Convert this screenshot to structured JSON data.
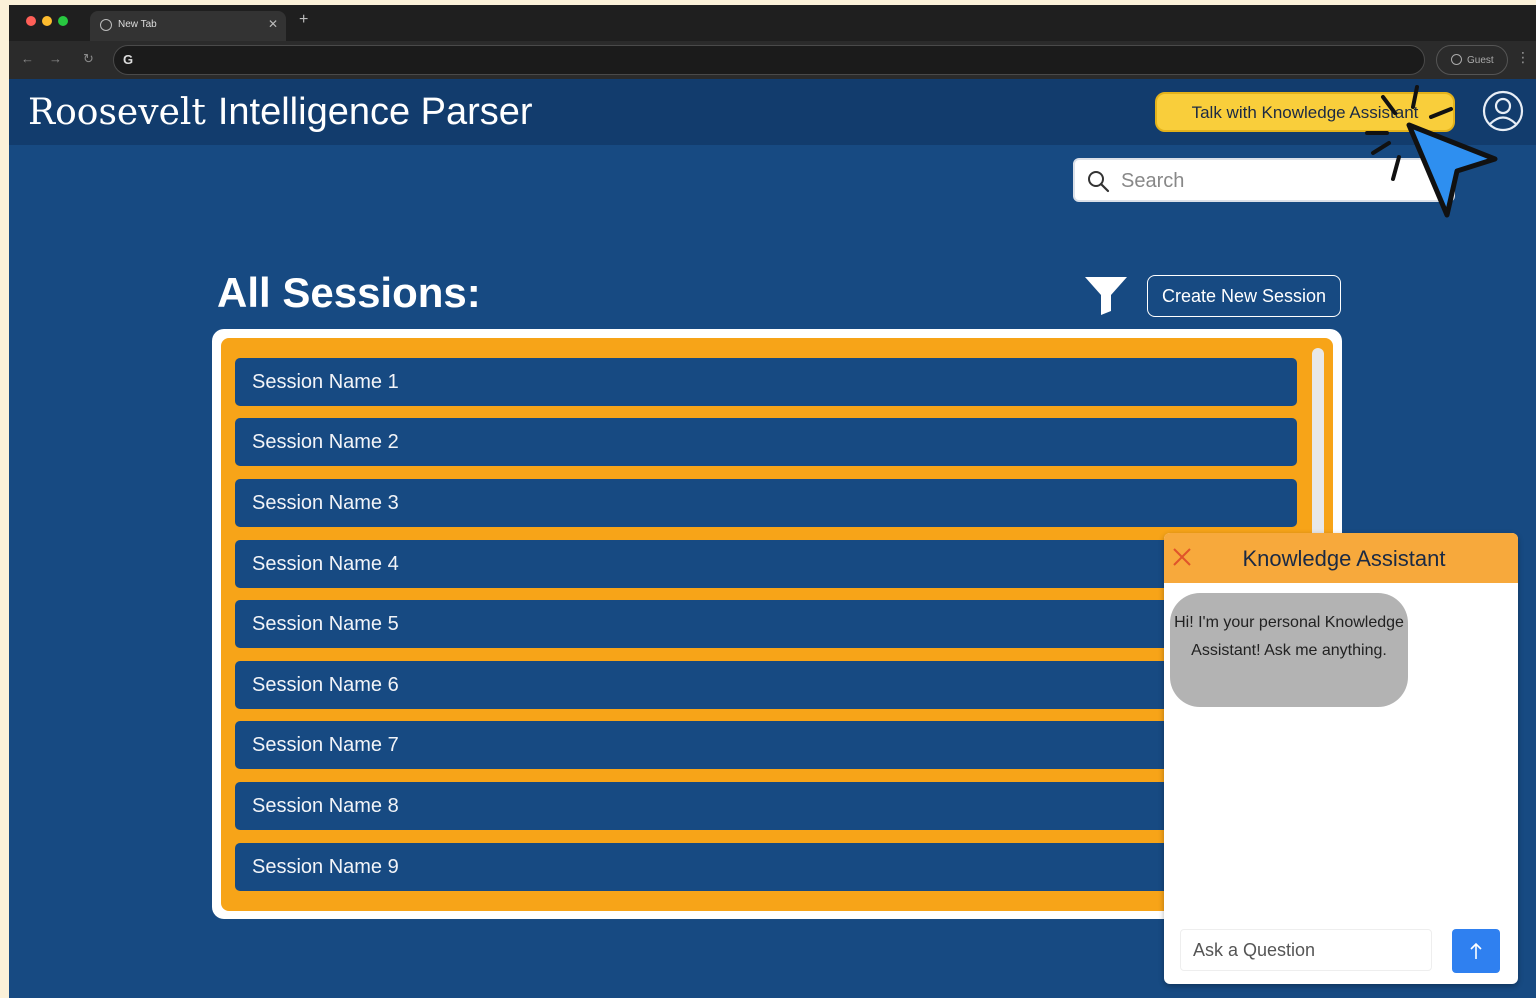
{
  "browser": {
    "tab_title": "New Tab",
    "omnibox_glyph": "G",
    "profile_label": "Guest"
  },
  "header": {
    "logo": "Roosevelt",
    "app_name": "Intelligence Parser",
    "talk_button": "Talk with Knowledge Assistant"
  },
  "search": {
    "placeholder": "Search"
  },
  "main": {
    "title": "All Sessions:",
    "create_button": "Create New Session",
    "sessions": [
      "Session Name 1",
      "Session Name 2",
      "Session Name 3",
      "Session Name 4",
      "Session Name 5",
      "Session Name 6",
      "Session Name 7",
      "Session Name 8",
      "Session Name 9"
    ]
  },
  "chat": {
    "title": "Knowledge Assistant",
    "greeting": "Hi! I'm your personal Knowledge Assistant! Ask me anything.",
    "input_placeholder": "Ask a Question"
  },
  "colors": {
    "app_background": "#174a82",
    "header_background": "#123c6d",
    "accent_orange": "#f7a418",
    "talk_button": "#f9ce3b",
    "send_button": "#2f80f0"
  }
}
